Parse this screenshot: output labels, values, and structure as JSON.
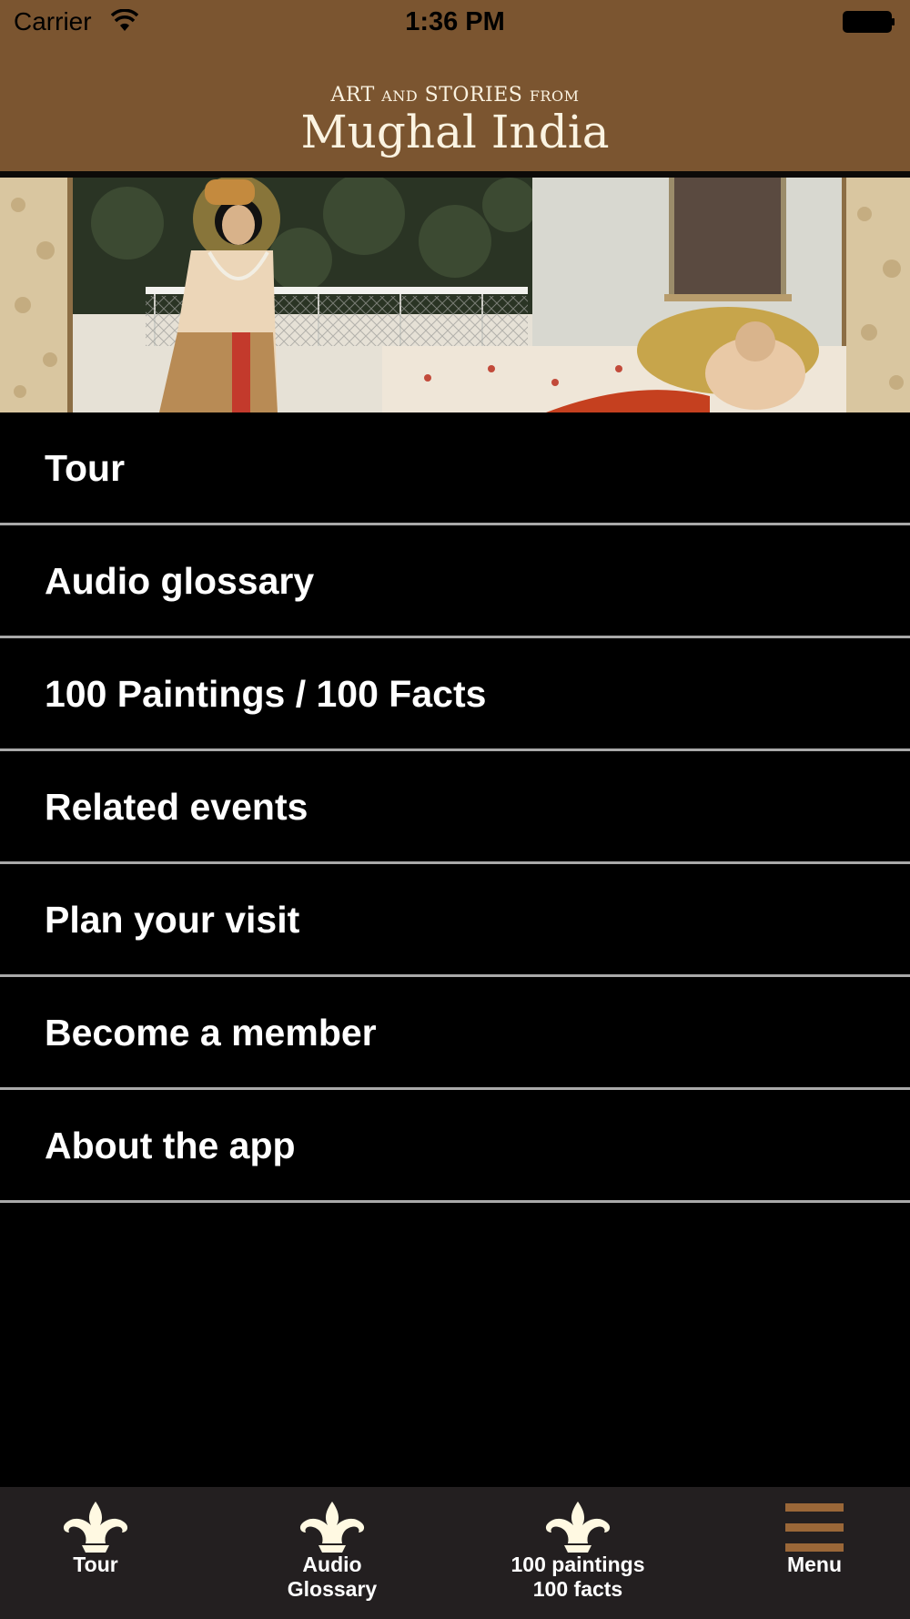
{
  "status_bar": {
    "carrier": "Carrier",
    "time": "1:36 PM"
  },
  "header": {
    "title_art": "ART",
    "title_and": "AND",
    "title_stories": "STORIES",
    "title_from": "FROM",
    "title_main": "Mughal India"
  },
  "menu": {
    "items": [
      {
        "label": "Tour"
      },
      {
        "label": "Audio glossary"
      },
      {
        "label": "100 Paintings / 100 Facts"
      },
      {
        "label": "Related events"
      },
      {
        "label": "Plan your visit"
      },
      {
        "label": "Become a member"
      },
      {
        "label": "About the app"
      }
    ]
  },
  "tab_bar": {
    "tabs": [
      {
        "line1": "Tour",
        "line2": "",
        "icon": "fleur-icon"
      },
      {
        "line1": "Audio",
        "line2": "Glossary",
        "icon": "fleur-icon"
      },
      {
        "line1": "100 paintings",
        "line2": "100 facts",
        "icon": "fleur-icon"
      },
      {
        "line1": "Menu",
        "line2": "",
        "icon": "hamburger-icon"
      }
    ]
  },
  "colors": {
    "header_brown": "#7b5530",
    "title_cream": "#fbf3e1",
    "tabbar_bg": "#231f20",
    "icon_cream": "#fff9e2",
    "menu_icon_brown": "#9a6738"
  }
}
